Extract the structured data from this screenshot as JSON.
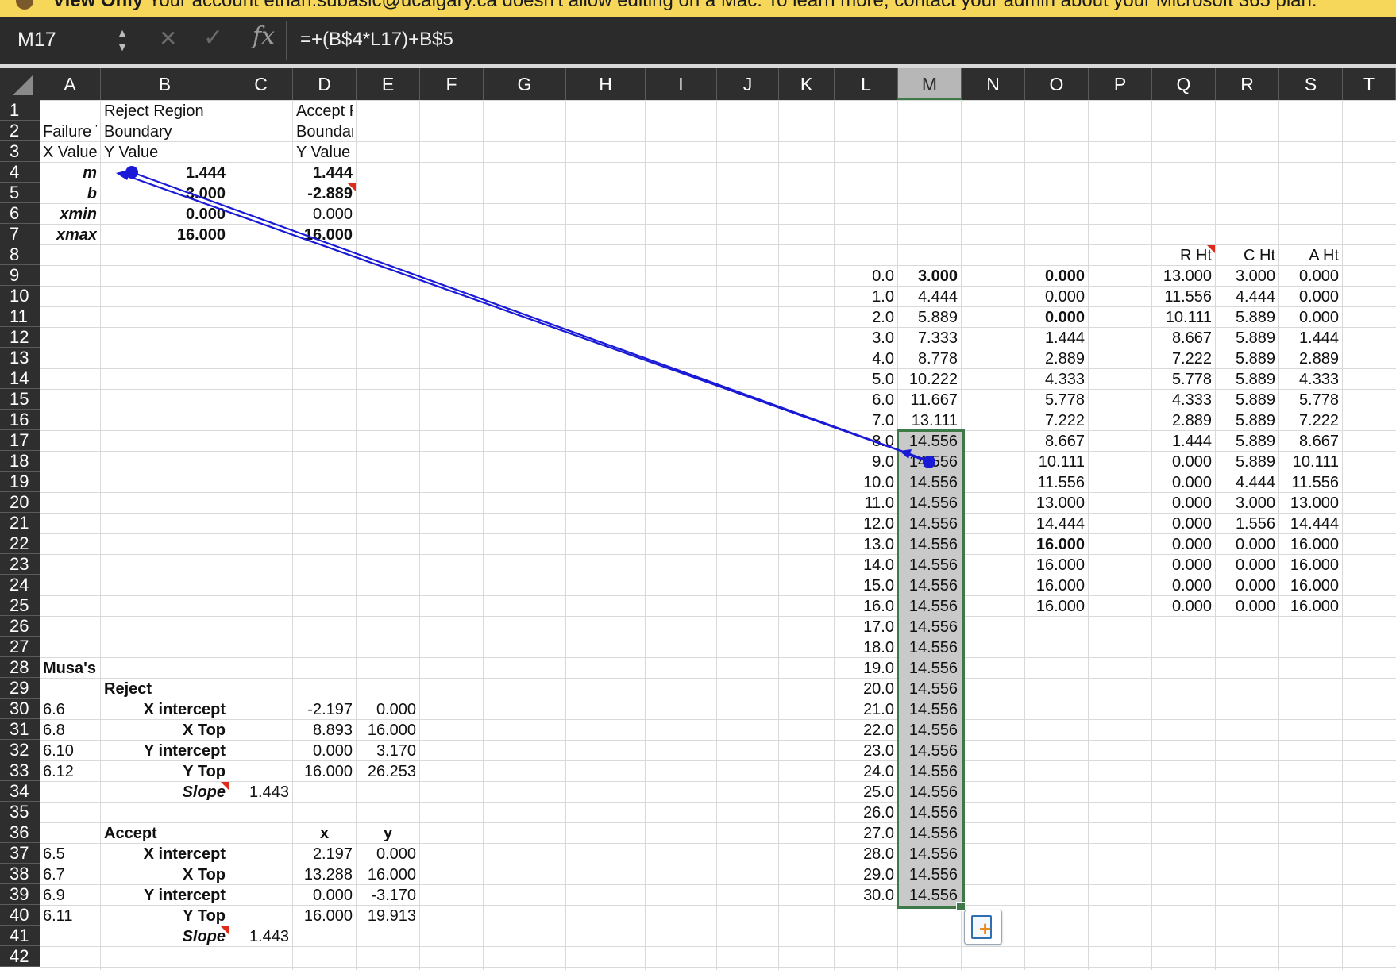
{
  "banner": {
    "bold": "View Only",
    "text": "Your account ethan.subasic@ucalgary.ca doesn't allow editing on a Mac. To learn more, contact your admin about your Microsoft 365 plan."
  },
  "formula_bar": {
    "name_box": "M17",
    "fx_label": "fx",
    "formula": "=+(B$4*L17)+B$5",
    "icons": [
      "stepper-icon",
      "cancel-x-icon",
      "enter-check-icon",
      "fx-icon"
    ]
  },
  "columns": [
    "A",
    "B",
    "C",
    "D",
    "E",
    "F",
    "G",
    "H",
    "I",
    "J",
    "K",
    "L",
    "M",
    "N",
    "O",
    "P",
    "Q",
    "R",
    "S",
    "T"
  ],
  "selected_column": "M",
  "rows": [
    "1",
    "2",
    "3",
    "4",
    "5",
    "6",
    "7",
    "8",
    "9",
    "10",
    "11",
    "12",
    "13",
    "14",
    "15",
    "16",
    "17",
    "18",
    "19",
    "20",
    "21",
    "22",
    "23",
    "24",
    "25",
    "26",
    "27",
    "28",
    "29",
    "30",
    "31",
    "32",
    "33",
    "34",
    "35",
    "36",
    "37",
    "38",
    "39",
    "40",
    "41",
    "42"
  ],
  "colors": {
    "selection": "#3e7a48",
    "trace_arrow": "#1a1ad6",
    "comment": "#e02a1a",
    "banner": "#f6d75a"
  },
  "cells": {
    "B1": "Reject Region",
    "D1": "Accept Region",
    "A2": "Failure T",
    "B2": "Boundary",
    "D2": "Boundary",
    "A3": "X Value",
    "B3": "Y Value",
    "D3": "Y Value",
    "A4": "m",
    "B4": "1.444",
    "D4": "1.444",
    "A5": "b",
    "B5": "3.000",
    "D5": "-2.889",
    "A6": "xmin",
    "B6": "0.000",
    "D6": "0.000",
    "A7": "xmax",
    "B7": "16.000",
    "D7": "16.000",
    "Q8": "R Ht",
    "R8": "C Ht",
    "S8": "A Ht",
    "A28": "Musa's Equations",
    "B29": "Reject",
    "A30": "6.6",
    "B30": "X intercept",
    "D30": "-2.197",
    "E30": "0.000",
    "A31": "6.8",
    "B31": "X Top",
    "D31": "8.893",
    "E31": "16.000",
    "A32": "6.10",
    "B32": "Y intercept",
    "D32": "0.000",
    "E32": "3.170",
    "A33": "6.12",
    "B33": "Y Top",
    "D33": "16.000",
    "E33": "26.253",
    "B34": "Slope",
    "C34": "1.443",
    "B36": "Accept",
    "D36": "x",
    "E36": "y",
    "A37": "6.5",
    "B37": "X intercept",
    "D37": "2.197",
    "E37": "0.000",
    "A38": "6.7",
    "B38": "X Top",
    "D38": "13.288",
    "E38": "16.000",
    "A39": "6.9",
    "B39": "Y intercept",
    "D39": "0.000",
    "E39": "-3.170",
    "A40": "6.11",
    "B40": "Y Top",
    "D40": "16.000",
    "E40": "19.913",
    "B41": "Slope",
    "C41": "1.443"
  },
  "table_L": [
    "0.0",
    "1.0",
    "2.0",
    "3.0",
    "4.0",
    "5.0",
    "6.0",
    "7.0",
    "8.0",
    "9.0",
    "10.0",
    "11.0",
    "12.0",
    "13.0",
    "14.0",
    "15.0",
    "16.0",
    "17.0",
    "18.0",
    "19.0",
    "20.0",
    "21.0",
    "22.0",
    "23.0",
    "24.0",
    "25.0",
    "26.0",
    "27.0",
    "28.0",
    "29.0",
    "30.0"
  ],
  "table_M": [
    "3.000",
    "4.444",
    "5.889",
    "7.333",
    "8.778",
    "10.222",
    "11.667",
    "13.111",
    "14.556",
    "14.556",
    "14.556",
    "14.556",
    "14.556",
    "14.556",
    "14.556",
    "14.556",
    "14.556",
    "14.556",
    "14.556",
    "14.556",
    "14.556",
    "14.556",
    "14.556",
    "14.556",
    "14.556",
    "14.556",
    "14.556",
    "14.556",
    "14.556",
    "14.556",
    "14.556"
  ],
  "table_O": [
    "0.000",
    "0.000",
    "0.000",
    "1.444",
    "2.889",
    "4.333",
    "5.778",
    "7.222",
    "8.667",
    "10.111",
    "11.556",
    "13.000",
    "14.444",
    "16.000",
    "16.000",
    "16.000",
    "16.000"
  ],
  "table_Q": [
    "13.000",
    "11.556",
    "10.111",
    "8.667",
    "7.222",
    "5.778",
    "4.333",
    "2.889",
    "1.444",
    "0.000",
    "0.000",
    "0.000",
    "0.000",
    "0.000",
    "0.000",
    "0.000",
    "0.000"
  ],
  "table_R": [
    "3.000",
    "4.444",
    "5.889",
    "5.889",
    "5.889",
    "5.889",
    "5.889",
    "5.889",
    "5.889",
    "5.889",
    "4.444",
    "3.000",
    "1.556",
    "0.000",
    "0.000",
    "0.000",
    "0.000"
  ],
  "table_S": [
    "0.000",
    "0.000",
    "0.000",
    "1.444",
    "2.889",
    "4.333",
    "5.778",
    "7.222",
    "8.667",
    "10.111",
    "11.556",
    "13.000",
    "14.444",
    "16.000",
    "16.000",
    "16.000",
    "16.000"
  ],
  "paste_options": {
    "icon": "paste-options-icon"
  }
}
